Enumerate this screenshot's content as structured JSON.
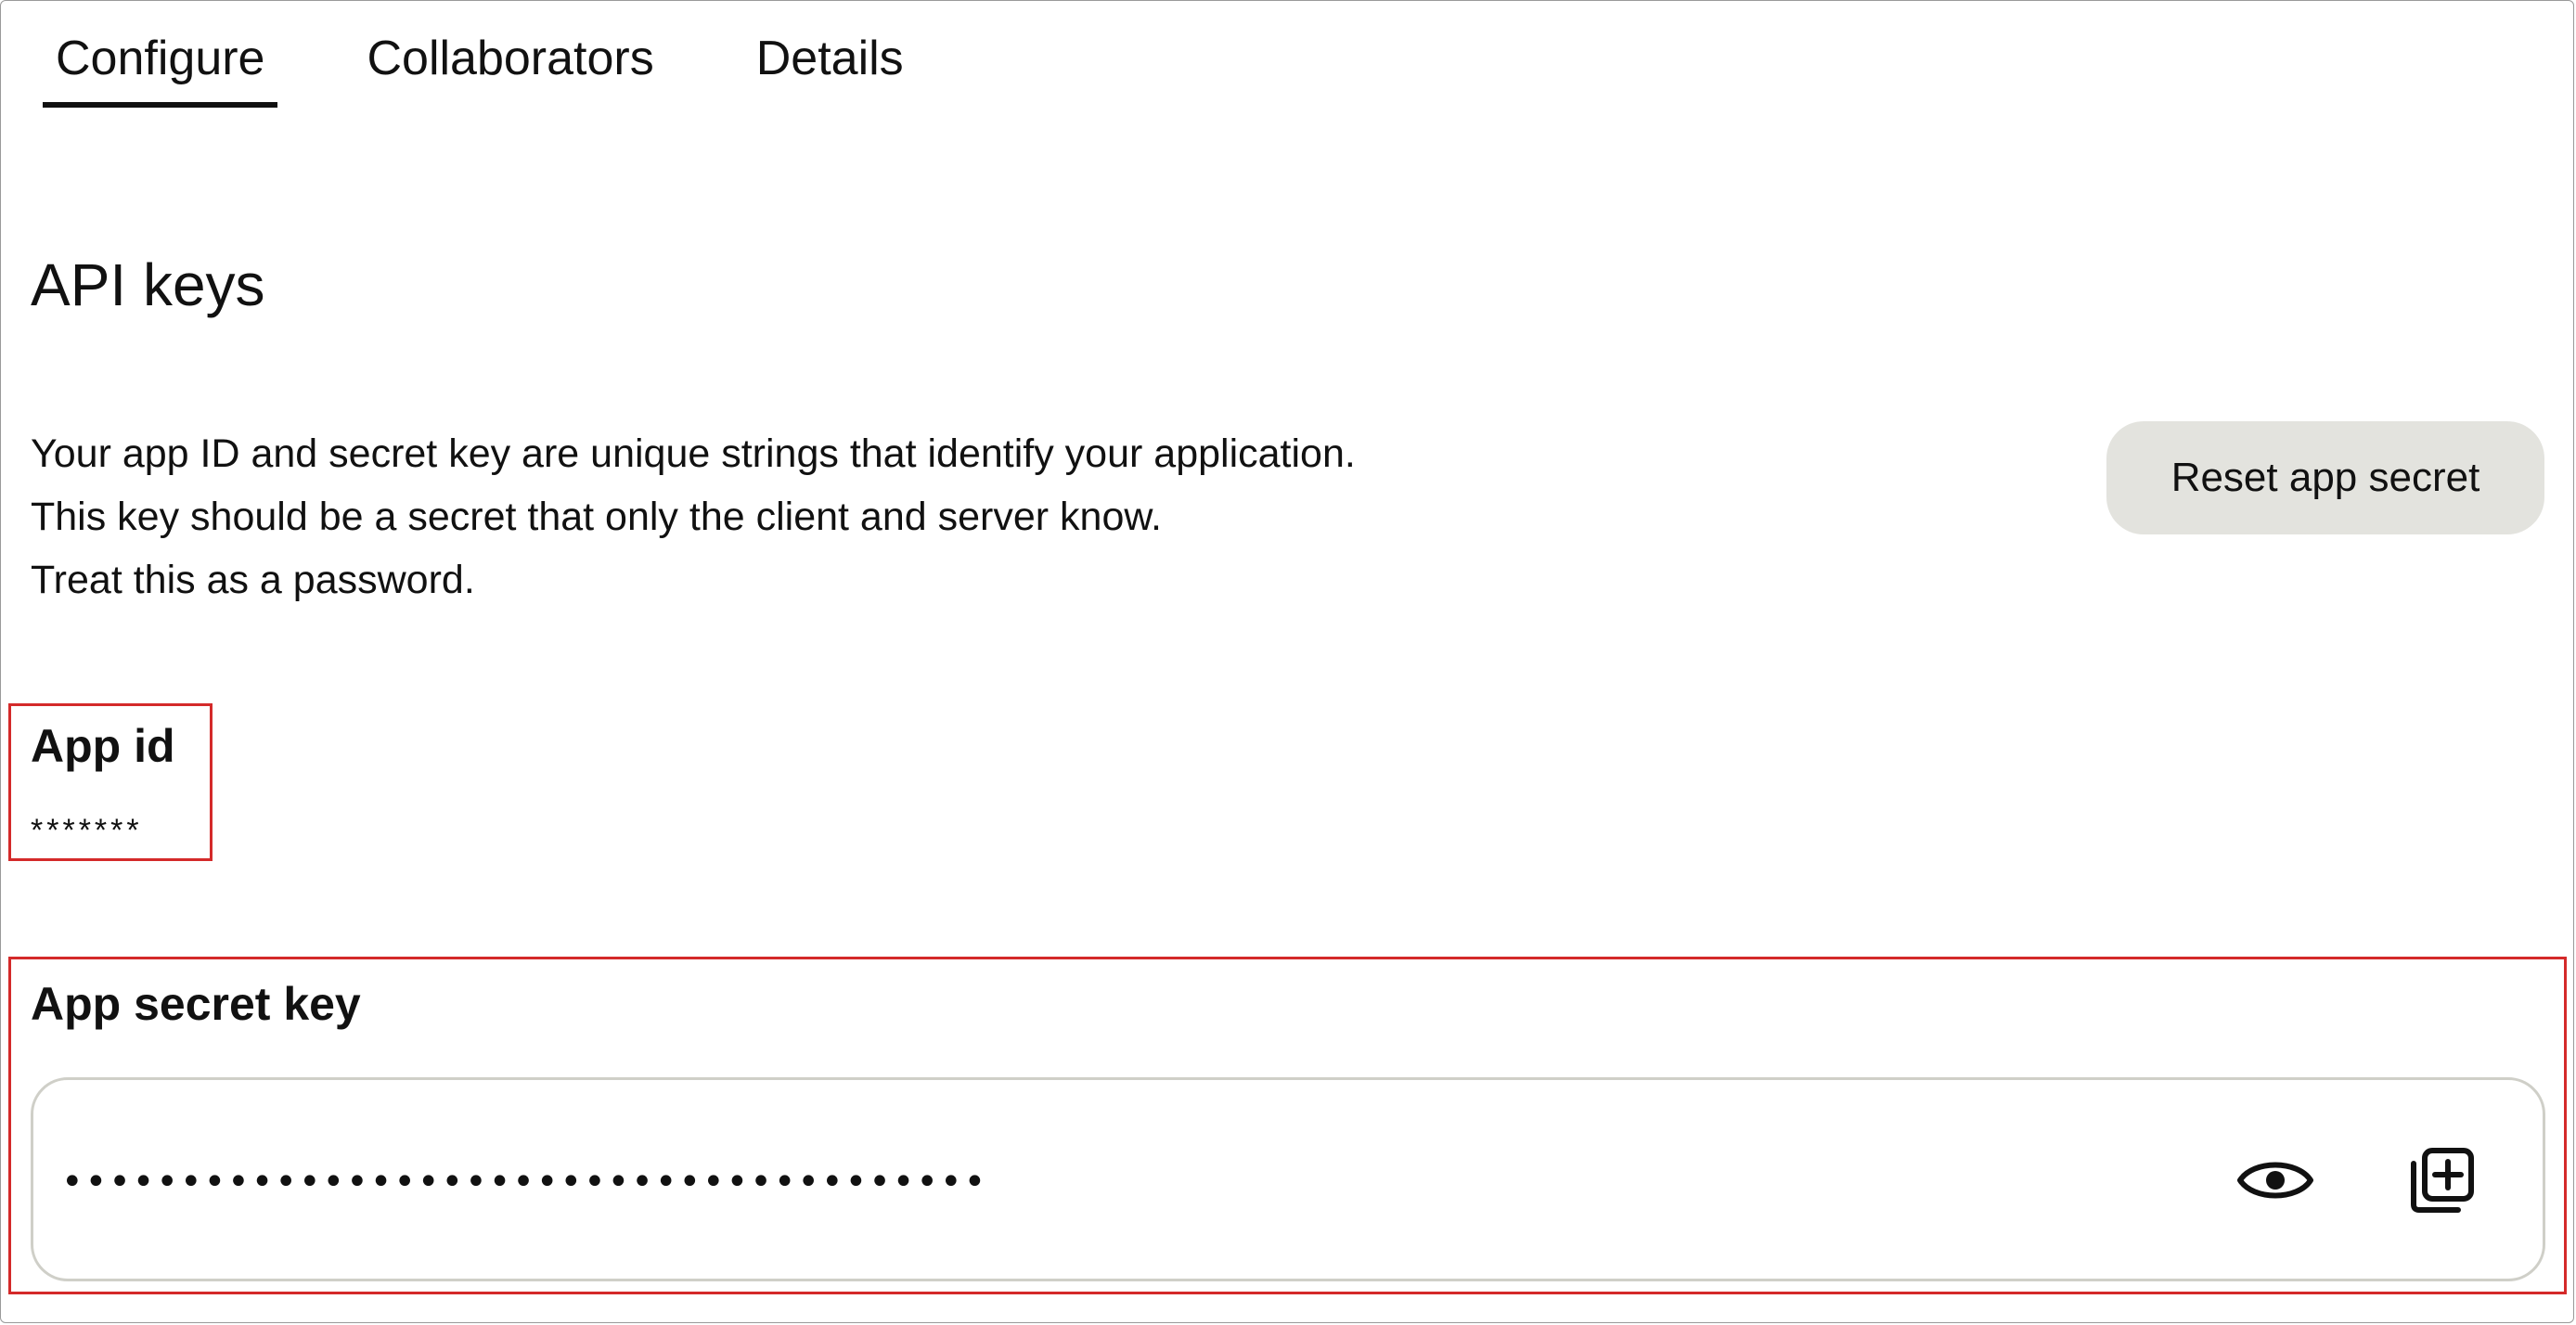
{
  "tabs": [
    {
      "label": "Configure",
      "active": true
    },
    {
      "label": "Collaborators",
      "active": false
    },
    {
      "label": "Details",
      "active": false
    }
  ],
  "section": {
    "title": "API keys",
    "description": [
      "Your app ID and secret key are unique strings that identify your application.",
      "This key should be a secret that only the client and server know.",
      "Treat this as a password."
    ],
    "reset_button_label": "Reset app secret"
  },
  "app_id": {
    "label": "App id",
    "value": "*******"
  },
  "app_secret": {
    "label": "App secret key",
    "value": "•••••••••••••••••••••••••••••••••••••••"
  },
  "icons": {
    "show_secret": "eye-icon",
    "copy_secret": "copy-icon"
  },
  "colors": {
    "highlight_border": "#d42a2a",
    "button_bg": "#e3e3de",
    "field_border": "#cfcfc8",
    "text": "#111111"
  }
}
